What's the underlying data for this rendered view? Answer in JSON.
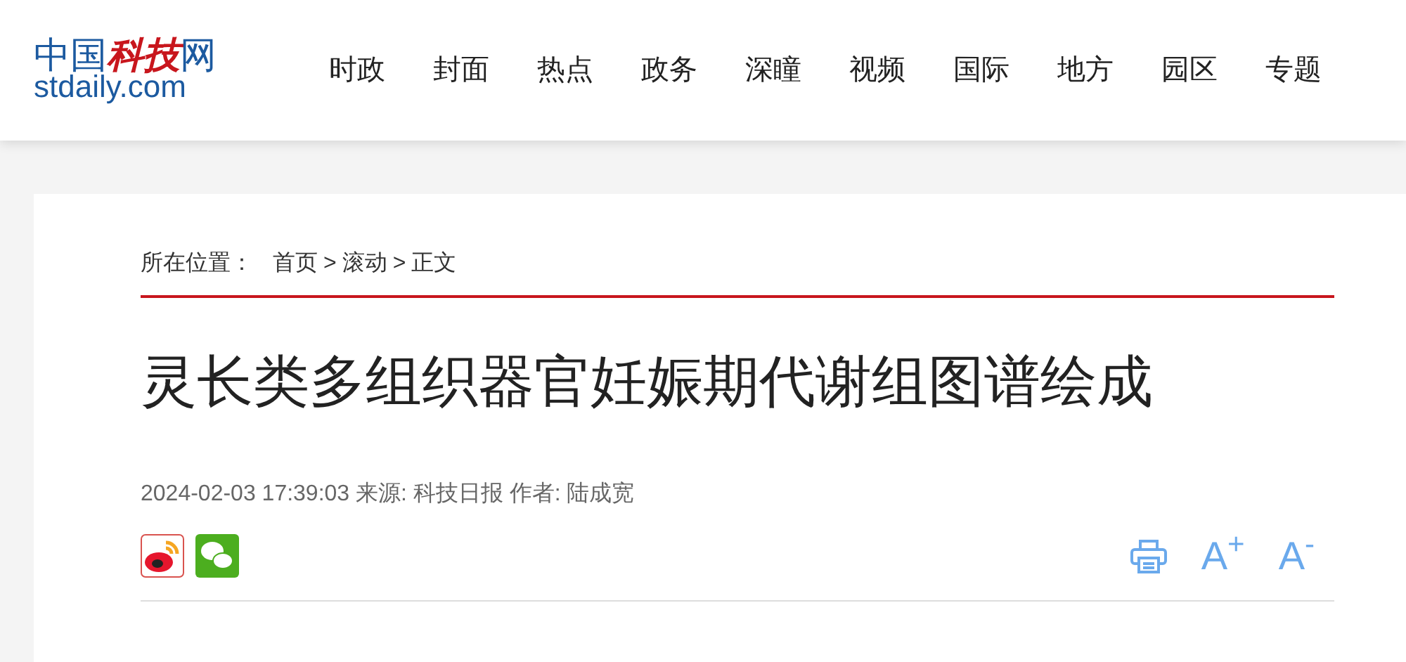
{
  "logo": {
    "cn_blue": "中国",
    "cn_red": "科技",
    "cn_tail": "网",
    "domain": "stdaily.com"
  },
  "nav": [
    "时政",
    "封面",
    "热点",
    "政务",
    "深瞳",
    "视频",
    "国际",
    "地方",
    "园区",
    "专题"
  ],
  "breadcrumb": {
    "label": "所在位置：",
    "items": [
      "首页",
      "滚动",
      "正文"
    ],
    "separator": ">"
  },
  "title": "灵长类多组织器官妊娠期代谢组图谱绘成",
  "meta": "2024-02-03 17:39:03 来源: 科技日报 作者: 陆成宽",
  "share": [
    {
      "kind": "weibo"
    },
    {
      "kind": "wechat"
    }
  ],
  "tools": [
    {
      "kind": "print"
    },
    {
      "kind": "font",
      "label": "A$^{+}$"
    },
    {
      "kind": "font",
      "label": "A$^{-}$"
    }
  ]
}
